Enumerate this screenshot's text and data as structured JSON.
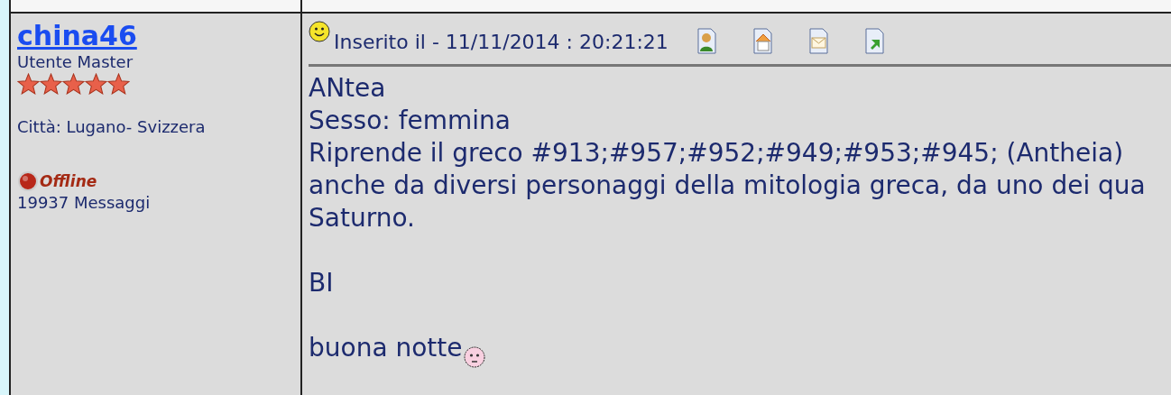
{
  "author": {
    "username": "china46",
    "rank": "Utente Master",
    "stars": 5,
    "city": "Città: Lugano- Svizzera",
    "status": "Offline",
    "online": false,
    "posts": "19937 Messaggi"
  },
  "post": {
    "posted": "Inserito il - 11/11/2014 : 20:21:21",
    "actions": [
      {
        "kind": "profile"
      },
      {
        "kind": "home"
      },
      {
        "kind": "email"
      },
      {
        "kind": "reply"
      }
    ],
    "lines": [
      {
        "text": "ANtea"
      },
      {
        "text": "Sesso: femmina"
      },
      {
        "text": "Riprende il greco #913;#957;#952;#949;#953;#945; (Antheia)"
      },
      {
        "text": "anche da diversi personaggi della mitologia greca, da uno dei qua"
      },
      {
        "text": "Saturno."
      },
      {
        "text": "BI",
        "blank_before": true
      },
      {
        "text": "buona notte",
        "emoticon": true,
        "blank_before": true
      }
    ]
  }
}
